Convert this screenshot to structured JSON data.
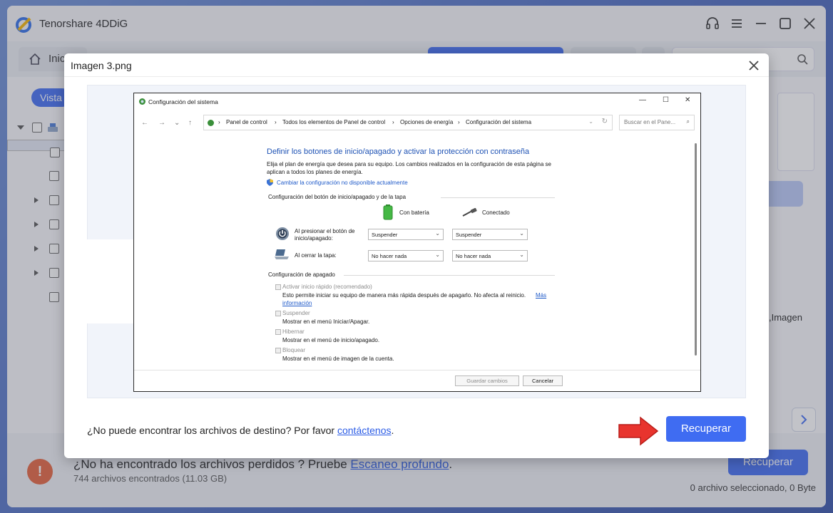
{
  "app": {
    "title": "Tenorshare 4DDiG",
    "home_tab": "Inic",
    "vista_label": "Vista",
    "right_image_label": ",Imagen",
    "footer": {
      "message": "¿No ha encontrado los archivos perdidos ? Pruebe ",
      "deep_scan_link": "Escaneo profundo",
      "message_end": ".",
      "count": "744 archivos encontrados (11.03 GB)",
      "recover_button": "Recuperar",
      "selected": "0 archivo seleccionado, 0 Byte"
    }
  },
  "dialog": {
    "title": "Imagen 3.png",
    "help_text": "¿No puede encontrar los archivos de destino? Por favor ",
    "contact_link": "contáctenos",
    "help_end": ".",
    "recover_button": "Recuperar"
  },
  "preview_window": {
    "title": "Configuración del sistema",
    "breadcrumb": [
      "Panel de control",
      "Todos los elementos de Panel de control",
      "Opciones de energía",
      "Configuración del sistema"
    ],
    "search_placeholder": "Buscar en el Pane...",
    "heading": "Definir los botones de inicio/apagado y activar la protección con contraseña",
    "intro_line1": "Elija el plan de energía que desea para su equipo. Los cambios realizados en la configuración de esta página se",
    "intro_line2": "aplican a todos los planes de energía.",
    "change_link": "Cambiar la configuración no disponible actualmente",
    "section_buttons": "Configuración del botón de inicio/apagado y de la tapa",
    "col_battery": "Con batería",
    "col_plugged": "Conectado",
    "row_power_line1": "Al presionar el botón de",
    "row_power_line2": "inicio/apagado:",
    "row_lid": "Al cerrar la tapa:",
    "power_battery": "Suspender",
    "power_plugged": "Suspender",
    "lid_battery": "No hacer nada",
    "lid_plugged": "No hacer nada",
    "section_shutdown": "Configuración de apagado",
    "fast_startup_label": "Activar inicio rápido (recomendado)",
    "fast_startup_desc": "Esto permite iniciar su equipo de manera más rápida después de apagarlo. No afecta al reinicio.",
    "more_info_1": "Más",
    "more_info_2": "información",
    "sleep_label": "Suspender",
    "sleep_desc": "Mostrar en el menú Iniciar/Apagar.",
    "hibernate_label": "Hibernar",
    "hibernate_desc": "Mostrar en el menú de inicio/apagado.",
    "lock_label": "Bloquear",
    "lock_desc": "Mostrar en el menú de imagen de la cuenta.",
    "save_button": "Guardar cambios",
    "cancel_button": "Cancelar"
  },
  "colors": {
    "accent": "#3f6cf2",
    "warning": "#e5613b",
    "arrow": "#e8342e",
    "link": "#2b5ce6"
  }
}
